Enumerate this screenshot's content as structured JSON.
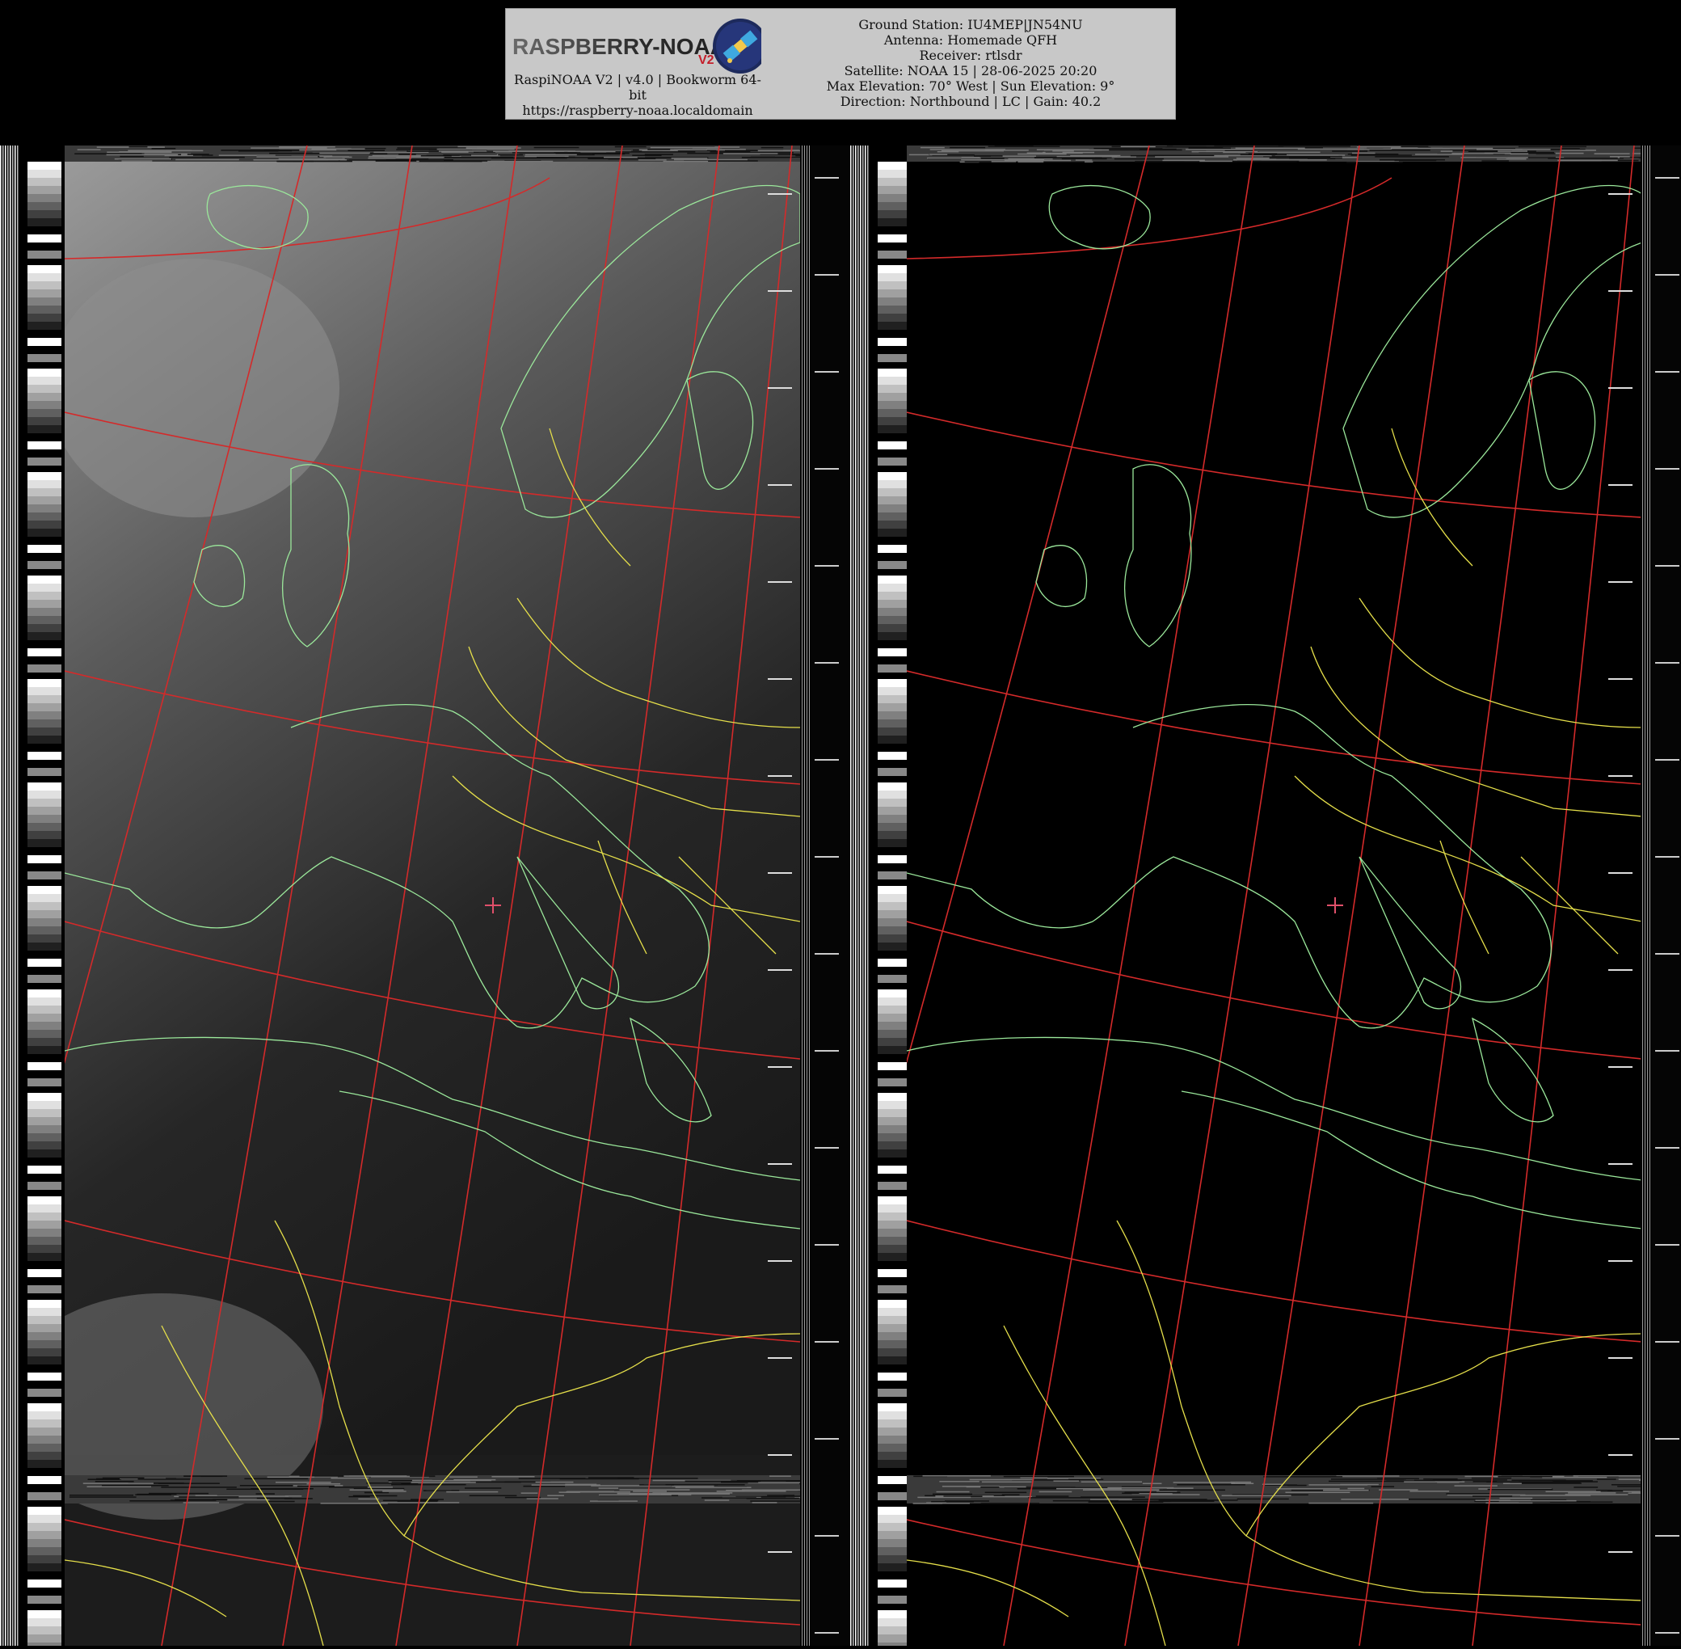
{
  "header": {
    "logo_text": "RASPBERRY-NOAA",
    "logo_badge": "V2",
    "caption_line1": "RaspiNOAA V2 | v4.0 | Bookworm 64-",
    "caption_line2": "bit",
    "caption_url": "https://raspberry-noaa.localdomain",
    "ground_station": "Ground Station: IU4MEP|JN54NU",
    "antenna": "Antenna: Homemade QFH",
    "receiver": "Receiver: rtlsdr",
    "satellite": "Satellite: NOAA 15 | 28-06-2025 20:20",
    "elevation": "Max Elevation: 70° West | Sun Elevation: 9°",
    "direction": "Direction: Northbound | LC | Gain: 40.2"
  },
  "colors": {
    "header_bg": "#c8c8c8",
    "graticule": "#d42a2a",
    "coastline": "#9be89b",
    "borders": "#e5df4a",
    "marker": "#e0506a"
  },
  "icons": {
    "logo": "satellite-logo-icon",
    "station_marker": "plus-marker-icon"
  }
}
